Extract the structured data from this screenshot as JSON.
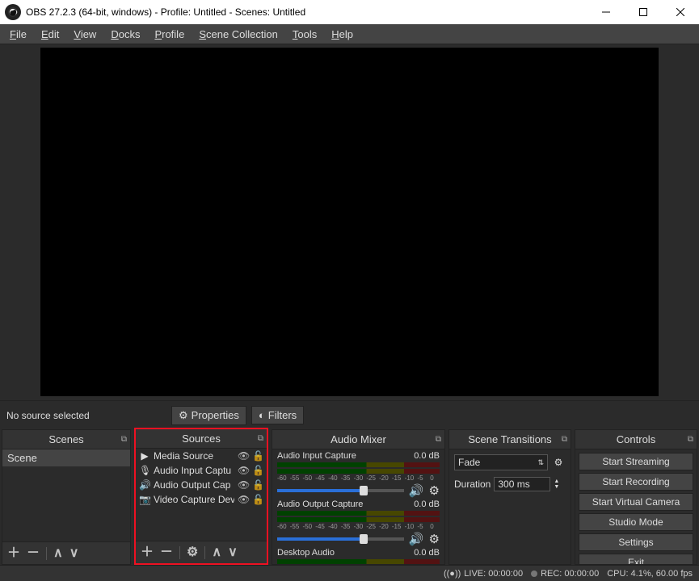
{
  "title": "OBS 27.2.3 (64-bit, windows) - Profile: Untitled - Scenes: Untitled",
  "menu": {
    "file": "File",
    "edit": "Edit",
    "view": "View",
    "docks": "Docks",
    "profile": "Profile",
    "scene_collection": "Scene Collection",
    "tools": "Tools",
    "help": "Help"
  },
  "toolbar": {
    "no_source": "No source selected",
    "properties": "Properties",
    "filters": "Filters"
  },
  "docks": {
    "scenes": "Scenes",
    "sources": "Sources",
    "mixer": "Audio Mixer",
    "transitions": "Scene Transitions",
    "controls": "Controls"
  },
  "scenes": {
    "items": [
      "Scene"
    ]
  },
  "sources": {
    "items": [
      {
        "icon": "▶",
        "label": "Media Source"
      },
      {
        "icon": "🎙",
        "label": "Audio Input Captu"
      },
      {
        "icon": "🔊",
        "label": "Audio Output Cap"
      },
      {
        "icon": "📷",
        "label": "Video Capture Dev"
      }
    ]
  },
  "mixer": {
    "ticks": [
      "-60",
      "-55",
      "-50",
      "-45",
      "-40",
      "-35",
      "-30",
      "-25",
      "-20",
      "-15",
      "-10",
      "-5",
      "0"
    ],
    "channels": [
      {
        "name": "Audio Input Capture",
        "db": "0.0 dB"
      },
      {
        "name": "Audio Output Capture",
        "db": "0.0 dB"
      },
      {
        "name": "Desktop Audio",
        "db": "0.0 dB"
      }
    ]
  },
  "transitions": {
    "type": "Fade",
    "duration_label": "Duration",
    "duration": "300 ms"
  },
  "controls": {
    "stream": "Start Streaming",
    "record": "Start Recording",
    "vcam": "Start Virtual Camera",
    "studio": "Studio Mode",
    "settings": "Settings",
    "exit": "Exit"
  },
  "status": {
    "live": "LIVE: 00:00:00",
    "rec": "REC: 00:00:00",
    "cpu": "CPU: 4.1%, 60.00 fps"
  }
}
